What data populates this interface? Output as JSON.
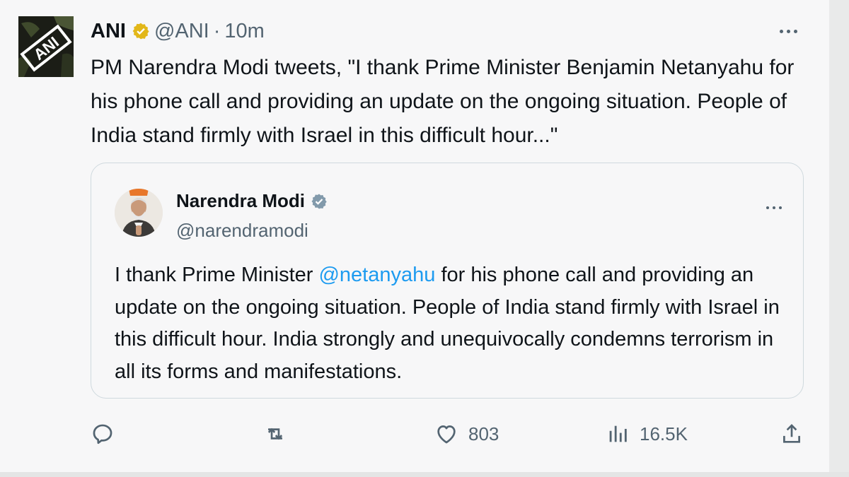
{
  "tweet": {
    "author_name": "ANI",
    "handle": "@ANI",
    "separator": "·",
    "time": "10m",
    "avatar_text": "ANI",
    "text": "PM Narendra Modi tweets, \"I thank Prime Minister Benjamin Netanyahu for his phone call and providing an update on the ongoing situation. People of India stand firmly with Israel in this difficult hour...\""
  },
  "quote": {
    "author_name": "Narendra Modi",
    "handle": "@narendramodi",
    "text_before": "I thank Prime Minister ",
    "mention": "@netanyahu",
    "text_after": " for his phone call and providing an update on the ongoing situation. People of India stand firmly with Israel in this difficult hour. India strongly and unequivocally condemns terrorism in all its forms and manifestations."
  },
  "actions": {
    "likes": "803",
    "views": "16.5K"
  },
  "icons": {
    "verified_gold": "verified-badge-gold-icon",
    "verified_blue": "verified-badge-blue-icon",
    "more": "more-horizontal-icon",
    "reply": "reply-icon",
    "retweet": "retweet-icon",
    "like": "heart-icon",
    "views": "views-bar-chart-icon",
    "share": "share-icon"
  },
  "colors": {
    "link": "#1d9bf0",
    "secondary_text": "#536471",
    "verified_gold": "#e2b719",
    "verified_blue": "#829aab"
  }
}
